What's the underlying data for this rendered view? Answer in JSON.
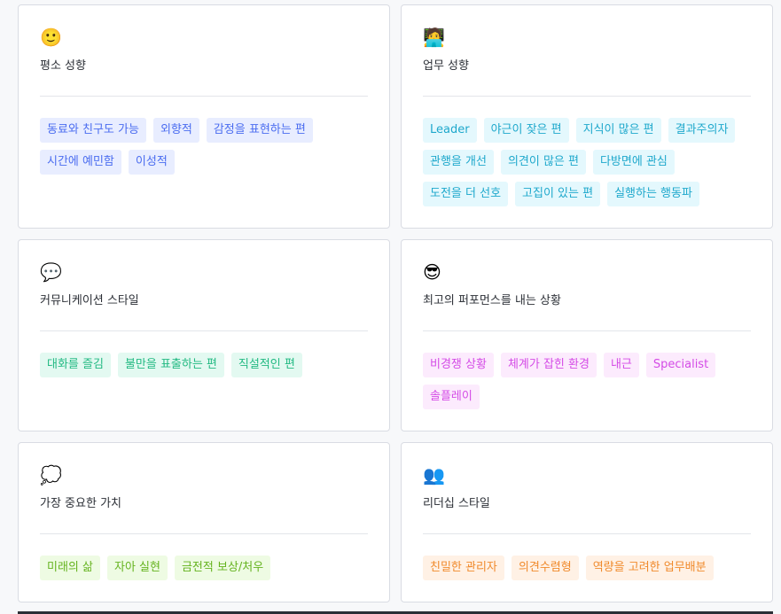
{
  "cards": [
    {
      "emoji": "🙂",
      "title": "평소 성향",
      "color": "blue",
      "tags": [
        "동료와 친구도 가능",
        "외향적",
        "감정을 표현하는 편",
        "시간에 예민함",
        "이성적"
      ]
    },
    {
      "emoji": "🧑‍💻",
      "title": "업무 성향",
      "color": "cyan",
      "tags": [
        "Leader",
        "야근이 잦은 편",
        "지식이 많은 편",
        "결과주의자",
        "관행을 개선",
        "의견이 많은 편",
        "다방면에 관심",
        "도전을 더 선호",
        "고집이 있는 편",
        "실행하는 행동파"
      ]
    },
    {
      "emoji": "💬",
      "title": "커뮤니케이션 스타일",
      "color": "green",
      "tags": [
        "대화를 즐김",
        "불만을 표출하는 편",
        "직설적인 편"
      ]
    },
    {
      "emoji": "😎",
      "title": "최고의 퍼포먼스를 내는 상황",
      "color": "pink",
      "tags": [
        "비경쟁 상황",
        "체계가 잡힌 환경",
        "내근",
        "Specialist",
        "솔플레이"
      ]
    },
    {
      "emoji": "💭",
      "title": "가장 중요한 가치",
      "color": "lime",
      "tags": [
        "미래의 삶",
        "자아 실현",
        "금전적 보상/처우"
      ]
    },
    {
      "emoji": "👥",
      "title": "리더십 스타일",
      "color": "orange",
      "tags": [
        "친밀한 관리자",
        "의견수렴형",
        "역량을 고려한 업무배분"
      ]
    }
  ],
  "palette": {
    "blue": "#4a6cf0",
    "cyan": "#1ea8cc",
    "green": "#21b982",
    "pink": "#d44be6",
    "lime": "#65b31f",
    "orange": "#f08a2c"
  }
}
